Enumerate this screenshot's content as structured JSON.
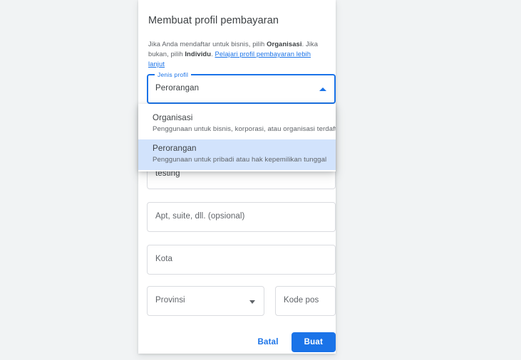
{
  "colors": {
    "background": "#f1f3f4",
    "surface": "#ffffff",
    "accent": "#1a73e8",
    "selected_row": "#d2e3fc",
    "text_primary": "#3c4043",
    "text_secondary": "#5f6368",
    "border": "#dadce0"
  },
  "dialog": {
    "title": "Membuat profil pembayaran",
    "description": {
      "part1": "Jika Anda mendaftar untuk bisnis, pilih ",
      "bold1": "Organisasi",
      "part2": ". Jika bukan, pilih ",
      "bold2": "Individu",
      "part3": ". ",
      "link": "Pelajari profil pembayaran lebih lanjut"
    }
  },
  "profile_type_select": {
    "label": "Jenis profil",
    "value": "Perorangan",
    "expanded": true,
    "arrow_icon": "chevron-up-icon"
  },
  "profile_type_menu": {
    "options": [
      {
        "title": "Organisasi",
        "subtitle": "Penggunaan untuk bisnis, korporasi, atau organisasi terdaftar",
        "selected": false
      },
      {
        "title": "Perorangan",
        "subtitle": "Penggunaan untuk pribadi atau hak kepemilikan tunggal",
        "selected": true
      }
    ]
  },
  "fields": {
    "address1": {
      "value": "testing",
      "placeholder": ""
    },
    "address2": {
      "value": "",
      "placeholder": "Apt, suite, dll. (opsional)"
    },
    "city": {
      "value": "",
      "placeholder": "Kota"
    },
    "province": {
      "value": "",
      "placeholder": "Provinsi",
      "arrow_icon": "chevron-down-icon"
    },
    "postal": {
      "value": "",
      "placeholder": "Kode pos"
    }
  },
  "actions": {
    "cancel_label": "Batal",
    "submit_label": "Buat"
  }
}
